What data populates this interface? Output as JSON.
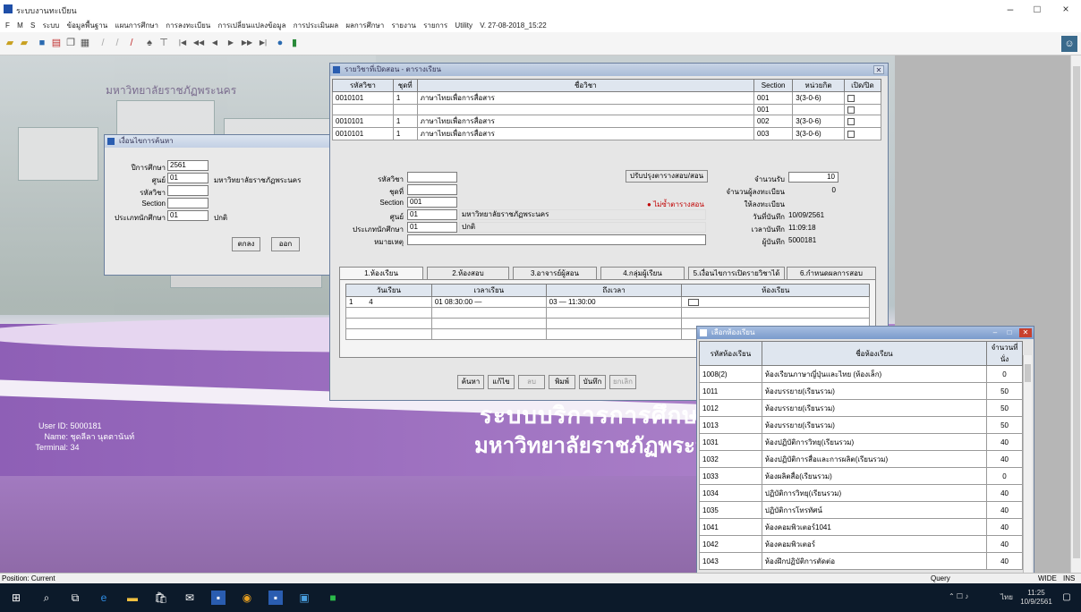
{
  "window": {
    "title": "ระบบงานทะเบียน",
    "minimize": "–",
    "maximize": "□",
    "close": "×"
  },
  "menu": [
    "F",
    "M",
    "S",
    "ระบบ",
    "ข้อมูลพื้นฐาน",
    "แผนการศึกษา",
    "การลงทะเบียน",
    "การเปลี่ยนแปลงข้อมูล",
    "การประเมินผล",
    "ผลการศึกษา",
    "รายงาน",
    "รายการ",
    "Utility",
    "V. 27-08-2018_15:22"
  ],
  "toolbar": {
    "record_nav": [
      "|◀",
      "◀◀",
      "◀",
      "▶",
      "▶▶",
      "▶|"
    ]
  },
  "background": {
    "university_small": "มหาวิทยาลัยราชภัฏพระนคร",
    "system_name": "ระบบบริการการศึกษา",
    "university_name": "มหาวิทยาลัยราชภัฏพระนคร",
    "user_id_label": "User ID:",
    "user_id": "5000181",
    "name_label": "Name:",
    "name": "ชุดลีลา นุตตานันท์",
    "terminal_label": "Terminal:",
    "terminal": "34"
  },
  "criteria": {
    "title": "เงื่อนไขการค้นหา",
    "year_label": "ปีการศึกษา",
    "year": "2561",
    "campus_label": "ศูนย์",
    "campus_code": "01",
    "campus_name": "มหาวิทยาลัยราชภัฏพระนคร",
    "course_label": "รหัสวิชา",
    "course": "",
    "section_label": "Section",
    "section": "",
    "type_label": "ประเภทนักศึกษา",
    "type_code": "01",
    "type_name": "ปกติ",
    "ok": "ตกลง",
    "exit": "ออก"
  },
  "main": {
    "title": "รายวิชาที่เปิดสอน - ตารางเรียน",
    "grid_headers": [
      "รหัสวิชา",
      "ชุดที่",
      "ชื่อวิชา",
      "Section",
      "หน่วยกิต",
      "เปิด/ปิด"
    ],
    "grid_rows": [
      {
        "code": "0010101",
        "set": "1",
        "name": "ภาษาไทยเพื่อการสื่อสาร",
        "section": "001",
        "credit": "3(3-0-6)"
      },
      {
        "code": "",
        "set": "",
        "name": "",
        "section": "001",
        "credit": ""
      },
      {
        "code": "0010101",
        "set": "1",
        "name": "ภาษาไทยเพื่อการสื่อสาร",
        "section": "002",
        "credit": "3(3-0-6)"
      },
      {
        "code": "0010101",
        "set": "1",
        "name": "ภาษาไทยเพื่อการสื่อสาร",
        "section": "003",
        "credit": "3(3-0-6)"
      }
    ],
    "detail": {
      "course_label": "รหัสวิชา",
      "course": "",
      "set_label": "ชุดที่",
      "set": "",
      "section_label": "Section",
      "section": "001",
      "campus_label": "ศูนย์",
      "campus_code": "01",
      "campus_name": "มหาวิทยาลัยราชภัฏพระนคร",
      "type_label": "ประเภทนักศึกษา",
      "type_code": "01",
      "type_name": "ปกติ",
      "note_label": "หมายเหตุ",
      "note": "",
      "update_button": "ปรับปรุงตารางสอบ/สอน",
      "status_text": "ไม่ซ้ำตารางสอน",
      "seats_label": "จำนวนรับ",
      "seats": "10",
      "registered_label": "จำนวนผู้ลงทะเบียน",
      "registered": "0",
      "allow_label": "ให้ลงทะเบียน",
      "date_label": "วันที่บันทึก",
      "date": "10/09/2561",
      "time_label": "เวลาบันทึก",
      "time": "11:09:18",
      "user_label": "ผู้บันทึก",
      "user": "5000181"
    },
    "tabs": [
      "1.ห้องเรียน",
      "2.ห้องสอบ",
      "3.อาจารย์ผู้สอน",
      "4.กลุ่มผู้เรียน",
      "5.เงื่อนไขการเปิดรายวิชาได้",
      "6.กำหนดผลการสอบ"
    ],
    "schedule_headers": [
      "วันเรียน",
      "เวลาเรียน",
      "ถึงเวลา",
      "ห้องเรียน"
    ],
    "schedule_row": {
      "day_no": "1",
      "day": "4",
      "from": "01 08:30:00",
      "from_end": "—",
      "to": "03",
      "to_end": "— 11:30:00",
      "room": ""
    },
    "buttons": [
      "ค้นหา",
      "แก้ไข",
      "ลบ",
      "พิมพ์",
      "บันทึก",
      "ยกเลิก"
    ]
  },
  "room_popup": {
    "title": "เลือกห้องเรียน",
    "headers": [
      "รหัสห้องเรียน",
      "ชื่อห้องเรียน",
      "จำนวนที่นั่ง"
    ],
    "rows": [
      {
        "code": "1008(2)",
        "name": "ห้องเรียนภาษาญี่ปุ่นและไทย (ห้องเล็ก)",
        "seats": "0"
      },
      {
        "code": "1011",
        "name": "ห้องบรรยาย(เรียนรวม)",
        "seats": "50"
      },
      {
        "code": "1012",
        "name": "ห้องบรรยาย(เรียนรวม)",
        "seats": "50"
      },
      {
        "code": "1013",
        "name": "ห้องบรรยาย(เรียนรวม)",
        "seats": "50"
      },
      {
        "code": "1031",
        "name": "ห้องปฏิบัติการวิทยุ(เรียนรวม)",
        "seats": "40"
      },
      {
        "code": "1032",
        "name": "ห้องปฏิบัติการสื่อและการผลิต(เรียนรวม)",
        "seats": "40"
      },
      {
        "code": "1033",
        "name": "ห้องผลิตสื่อ(เรียนรวม)",
        "seats": "0"
      },
      {
        "code": "1034",
        "name": "ปฏิบัติการวิทยุ(เรียนรวม)",
        "seats": "40"
      },
      {
        "code": "1035",
        "name": "ปฏิบัติการโทรทัศน์",
        "seats": "40"
      },
      {
        "code": "1041",
        "name": "ห้องคอมพิวเตอร์1041",
        "seats": "40"
      },
      {
        "code": "1042",
        "name": "ห้องคอมพิวเตอร์",
        "seats": "40"
      },
      {
        "code": "1043",
        "name": "ห้องฝึกปฏิบัติการตัดต่อ",
        "seats": "40"
      }
    ]
  },
  "statusbar": {
    "left": "Position: Current",
    "mode": "Query",
    "w": "WIDE",
    "ins": "INS"
  },
  "taskbar": {
    "time": "11:25",
    "date": "10/9/2561",
    "lang": "ไทย"
  }
}
